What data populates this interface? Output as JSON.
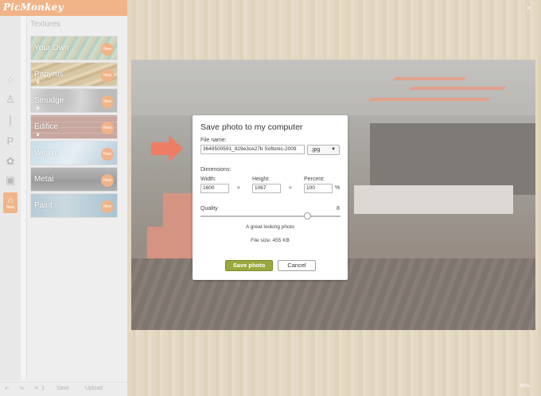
{
  "app": {
    "logo": "PicMonkey",
    "close_icon": "×",
    "zoom": "60%"
  },
  "sidebar": {
    "panel_title": "Textures",
    "textures": [
      {
        "label": "Your Own",
        "badge": "New"
      },
      {
        "label": "Papyrus",
        "badge": "New"
      },
      {
        "label": "Smudge",
        "badge": "New"
      },
      {
        "label": "Edifice",
        "badge": "New"
      },
      {
        "label": "Weave",
        "badge": "New"
      },
      {
        "label": "Metal",
        "badge": "New"
      },
      {
        "label": "Paint",
        "badge": "New"
      }
    ],
    "active_tool_badge": "New",
    "tools": [
      "crop-icon",
      "brush-icon",
      "pencil-icon",
      "text-p-icon",
      "butterfly-icon",
      "frame-icon",
      "texture-icon"
    ]
  },
  "bottom_bar": {
    "undo_icon": "↶",
    "redo_icon": "↷",
    "history_icon": "≡",
    "history_count": "1",
    "save": "Save",
    "upload": "Upload"
  },
  "dialog": {
    "title": "Save photo to my computer",
    "file_name_label": "File name:",
    "file_name_value": "3649500591_929e3ce27b Softonic-2009",
    "format": ".jpg",
    "dimensions_label": "Dimensions:",
    "width_label": "Width:",
    "width_value": "1600",
    "height_label": "Height:",
    "height_value": "1067",
    "percent_label": "Percent:",
    "percent_value": "100",
    "percent_sign": "%",
    "quality_label": "Quality",
    "quality_value": "8",
    "quality_message": "A great looking photo",
    "file_size": "File size: 455 KB",
    "save_button": "Save photo",
    "cancel_button": "Cancel"
  },
  "colors": {
    "accent": "#f0b488",
    "save_button": "#9aa83c",
    "arrow": "#e8593a"
  }
}
